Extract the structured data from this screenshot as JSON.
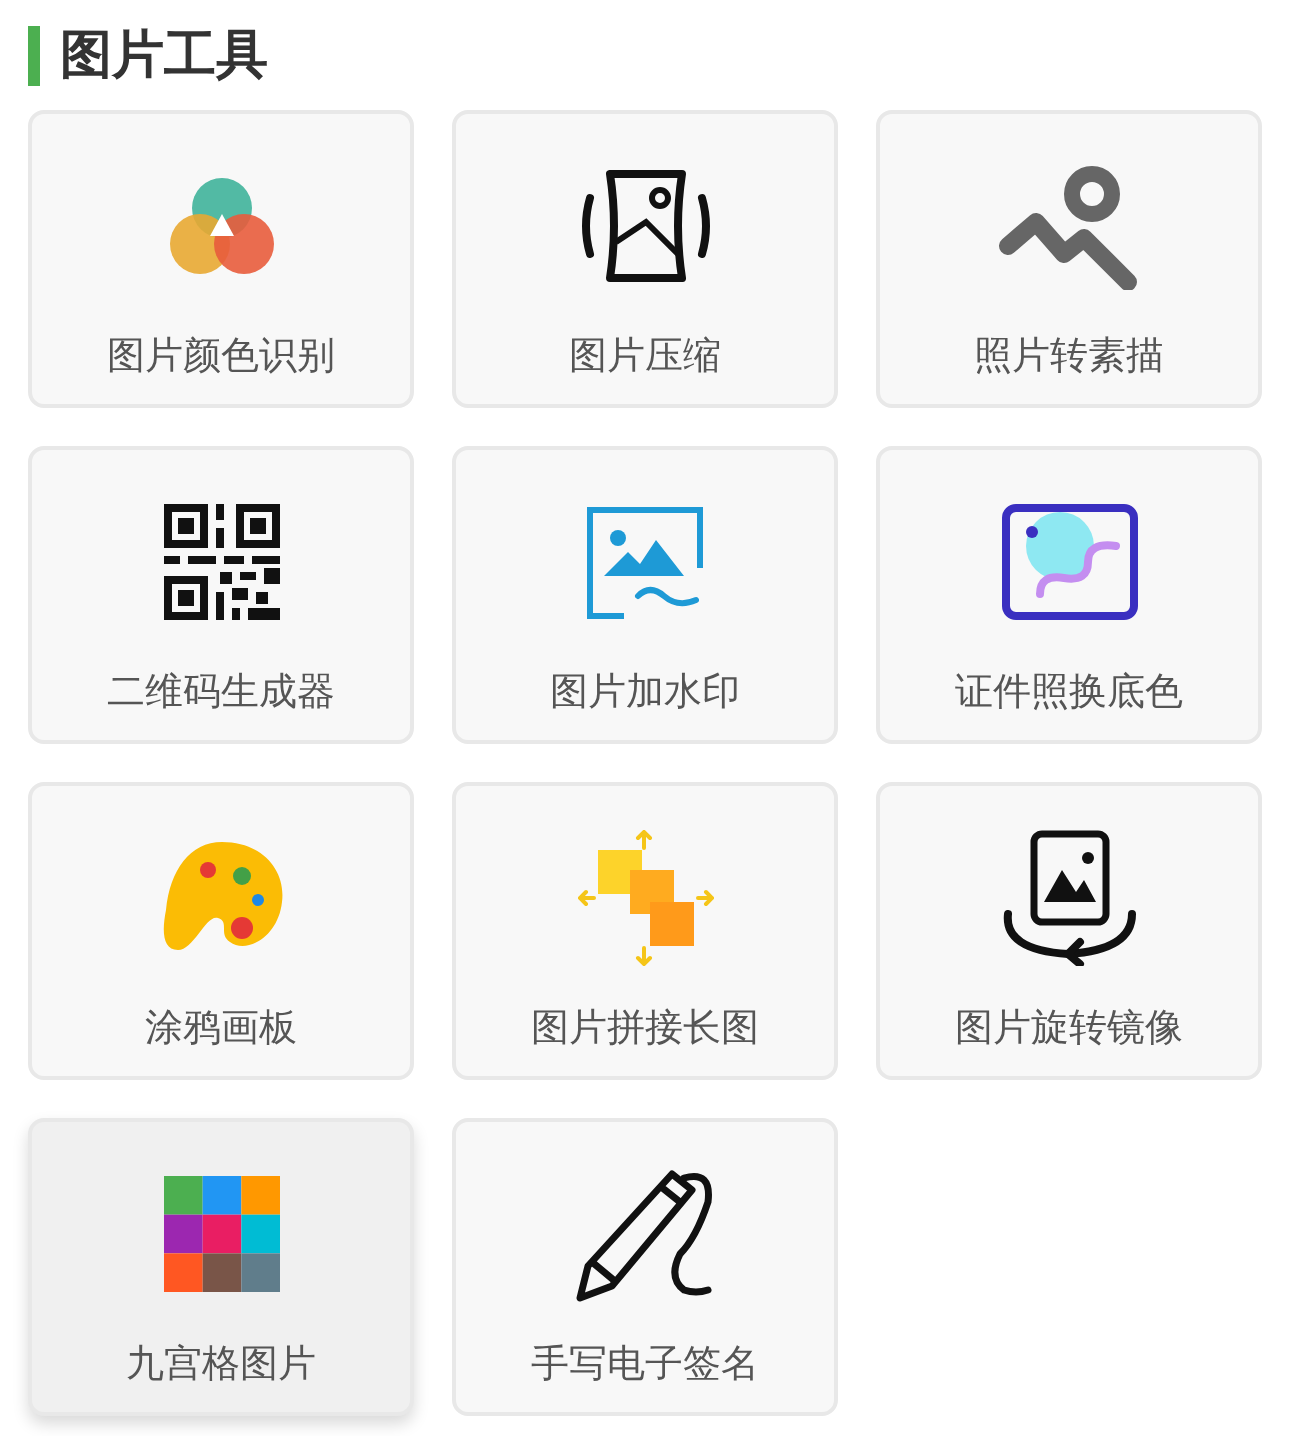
{
  "section": {
    "title": "图片工具"
  },
  "tools": [
    {
      "kind": "color",
      "label": "图片颜色识别",
      "highlighted": false
    },
    {
      "kind": "compress",
      "label": "图片压缩",
      "highlighted": false
    },
    {
      "kind": "sketch",
      "label": "照片转素描",
      "highlighted": false
    },
    {
      "kind": "qrcode",
      "label": "二维码生成器",
      "highlighted": false
    },
    {
      "kind": "watermark",
      "label": "图片加水印",
      "highlighted": false
    },
    {
      "kind": "idphoto",
      "label": "证件照换底色",
      "highlighted": false
    },
    {
      "kind": "palette",
      "label": "涂鸦画板",
      "highlighted": false
    },
    {
      "kind": "stitch",
      "label": "图片拼接长图",
      "highlighted": false
    },
    {
      "kind": "rotate",
      "label": "图片旋转镜像",
      "highlighted": false
    },
    {
      "kind": "grid",
      "label": "九宫格图片",
      "highlighted": true
    },
    {
      "kind": "signature",
      "label": "手写电子签名",
      "highlighted": false
    }
  ]
}
